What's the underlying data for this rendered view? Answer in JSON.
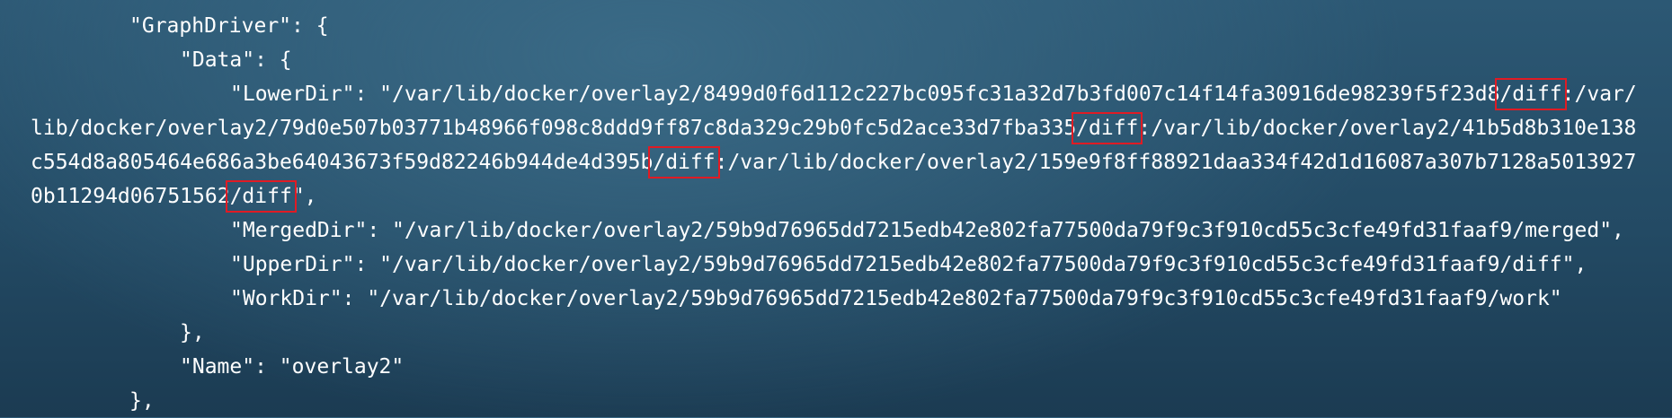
{
  "lines": {
    "graphdriver_open": "\"GraphDriver\": {",
    "data_open": "\"Data\": {",
    "lowerdir_1a": "\"LowerDir\": \"/var/lib/docker/overlay2/8499d0f6d112c227bc095fc31a32d7b3fd007c14f14fa30916de98239f5f23d8",
    "lowerdir_1b": ":/var/",
    "lowerdir_2a": "lib/docker/overlay2/79d0e507b03771b48966f098c8ddd9ff87c8da329c29b0fc5d2ace33d7fba335",
    "lowerdir_2b": ":/var/lib/docker/overlay2/41b5d8b310e138",
    "lowerdir_3a": "c554d8a805464e686a3be64043673f59d82246b944de4d395b",
    "lowerdir_3b": ":/var/lib/docker/overlay2/159e9f8ff88921daa334f42d1d16087a307b7128a5013927",
    "lowerdir_4a": "0b11294d06751562",
    "lowerdir_4b": "\",",
    "diff": "/diff",
    "mergeddir": "\"MergedDir\": \"/var/lib/docker/overlay2/59b9d76965dd7215edb42e802fa77500da79f9c3f910cd55c3cfe49fd31faaf9/merged\",",
    "upperdir": "\"UpperDir\": \"/var/lib/docker/overlay2/59b9d76965dd7215edb42e802fa77500da79f9c3f910cd55c3cfe49fd31faaf9/diff\",",
    "workdir": "\"WorkDir\": \"/var/lib/docker/overlay2/59b9d76965dd7215edb42e802fa77500da79f9c3f910cd55c3cfe49fd31faaf9/work\"",
    "data_close": "},",
    "name": "\"Name\": \"overlay2\"",
    "graphdriver_close": "},"
  },
  "colors": {
    "highlight_box": "#e01b24",
    "text": "#ffffff",
    "background": "#2c5874"
  }
}
